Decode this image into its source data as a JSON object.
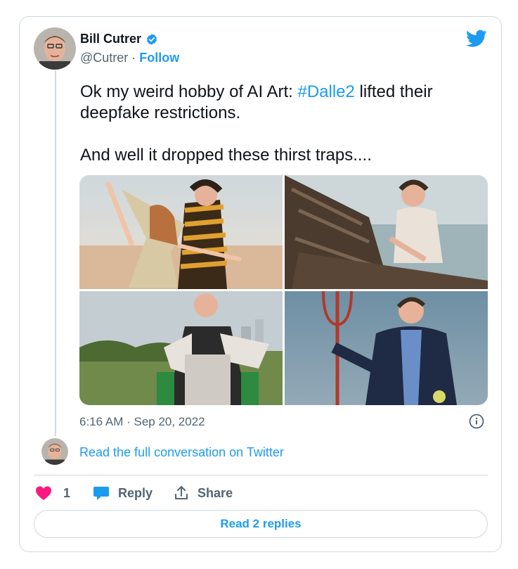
{
  "author": {
    "name": "Bill Cutrer",
    "handle": "@Cutrer",
    "separator": " · ",
    "follow_label": "Follow"
  },
  "tweet": {
    "text_before_hashtag": "Ok my weird hobby of AI Art: ",
    "hashtag": "#Dalle2",
    "text_after_hashtag": " lifted their deepfake restrictions.",
    "second_paragraph": "And well it dropped these thirst traps....",
    "timestamp": "6:16 AM · Sep 20, 2022"
  },
  "conversation": {
    "link_label": "Read the full conversation on Twitter"
  },
  "actions": {
    "like_count": "1",
    "reply_label": "Reply",
    "share_label": "Share"
  },
  "replies_button_label": "Read 2 replies",
  "colors": {
    "accent": "#1d9bf0",
    "like": "#f91880",
    "muted": "#536471",
    "border": "#cfd9de"
  },
  "icons": [
    "verified-badge-icon",
    "twitter-bird-icon",
    "info-icon",
    "heart-icon",
    "reply-bubble-icon",
    "share-icon"
  ],
  "media_tiles": [
    "photo-beach-dance",
    "photo-boat-woman",
    "photo-armor-field",
    "photo-trident-suit"
  ]
}
